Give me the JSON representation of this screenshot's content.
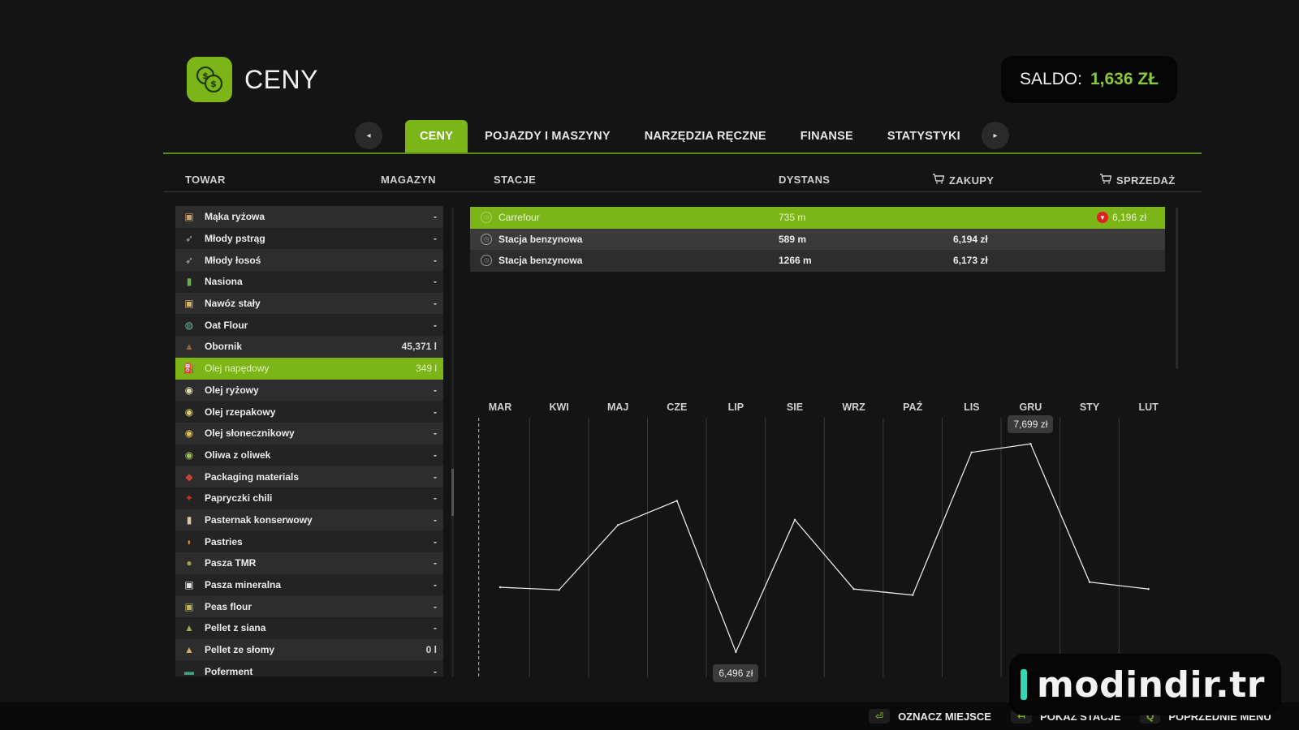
{
  "header": {
    "title": "CENY",
    "icon": "coins-icon"
  },
  "saldo": {
    "label": "SALDO:",
    "value": "1,636 ZŁ"
  },
  "tabs": {
    "prev_icon": "◂",
    "next_icon": "▸",
    "items": [
      {
        "label": "CENY",
        "active": true
      },
      {
        "label": "POJAZDY I MASZYNY",
        "active": false
      },
      {
        "label": "NARZĘDZIA RĘCZNE",
        "active": false
      },
      {
        "label": "FINANSE",
        "active": false
      },
      {
        "label": "STATYSTYKI",
        "active": false
      }
    ]
  },
  "columns": {
    "towar": "TOWAR",
    "magazyn": "MAGAZYN",
    "stacje": "STACJE",
    "dystans": "DYSTANS",
    "zakupy": "ZAKUPY",
    "sprzedaz": "SPRZEDAŻ"
  },
  "goods": [
    {
      "name": "Mąka ryżowa",
      "qty": "-",
      "icon": "▣",
      "color": "#c9a46a"
    },
    {
      "name": "Młody pstrąg",
      "qty": "-",
      "icon": "➶",
      "color": "#9fb0a0"
    },
    {
      "name": "Młody łosoś",
      "qty": "-",
      "icon": "➶",
      "color": "#b0b0b0"
    },
    {
      "name": "Nasiona",
      "qty": "-",
      "icon": "▮",
      "color": "#6ab04c"
    },
    {
      "name": "Nawóz stały",
      "qty": "-",
      "icon": "▣",
      "color": "#d9b36a"
    },
    {
      "name": "Oat Flour",
      "qty": "-",
      "icon": "◍",
      "color": "#6fb0a0"
    },
    {
      "name": "Obornik",
      "qty": "45,371 l",
      "icon": "▲",
      "color": "#8a6a3a"
    },
    {
      "name": "Olej napędowy",
      "qty": "349 l",
      "icon": "⛽",
      "color": "#d0d0d0",
      "selected": true
    },
    {
      "name": "Olej ryżowy",
      "qty": "-",
      "icon": "◉",
      "color": "#e0e0b0"
    },
    {
      "name": "Olej rzepakowy",
      "qty": "-",
      "icon": "◉",
      "color": "#e0d070"
    },
    {
      "name": "Olej słonecznikowy",
      "qty": "-",
      "icon": "◉",
      "color": "#e0c050"
    },
    {
      "name": "Oliwa z oliwek",
      "qty": "-",
      "icon": "◉",
      "color": "#a0c060"
    },
    {
      "name": "Packaging materials",
      "qty": "-",
      "icon": "◆",
      "color": "#d04030"
    },
    {
      "name": "Papryczki chili",
      "qty": "-",
      "icon": "✦",
      "color": "#d03020"
    },
    {
      "name": "Pasternak konserwowy",
      "qty": "-",
      "icon": "▮",
      "color": "#d8c8a8"
    },
    {
      "name": "Pastries",
      "qty": "-",
      "icon": "◗",
      "color": "#d89030"
    },
    {
      "name": "Pasza TMR",
      "qty": "-",
      "icon": "●",
      "color": "#a0a050"
    },
    {
      "name": "Pasza mineralna",
      "qty": "-",
      "icon": "▣",
      "color": "#e0e0e0"
    },
    {
      "name": "Peas flour",
      "qty": "-",
      "icon": "▣",
      "color": "#c0b060"
    },
    {
      "name": "Pellet z siana",
      "qty": "-",
      "icon": "▲",
      "color": "#90b050"
    },
    {
      "name": "Pellet ze słomy",
      "qty": "0 l",
      "icon": "▲",
      "color": "#d0b060"
    },
    {
      "name": "Poferment",
      "qty": "-",
      "icon": "▬",
      "color": "#40a080"
    }
  ],
  "stations": [
    {
      "name": "Carrefour",
      "distance": "735 m",
      "buy": "",
      "sell": "6,196 zł",
      "selected": true,
      "trend": "down"
    },
    {
      "name": "Stacja benzynowa",
      "distance": "589 m",
      "buy": "6,194 zł",
      "sell": ""
    },
    {
      "name": "Stacja benzynowa",
      "distance": "1266 m",
      "buy": "6,173 zł",
      "sell": ""
    }
  ],
  "chart_data": {
    "type": "line",
    "categories": [
      "MAR",
      "KWI",
      "MAJ",
      "CZE",
      "LIP",
      "SIE",
      "WRZ",
      "PAŹ",
      "LIS",
      "GRU",
      "STY",
      "LUT"
    ],
    "series": [
      {
        "values": [
          6870,
          6855,
          7230,
          7370,
          6496,
          7260,
          6860,
          6825,
          7650,
          7699,
          6900,
          6860
        ]
      }
    ],
    "annotations": [
      {
        "month": "LIP",
        "label": "6,496 zł"
      },
      {
        "month": "GRU",
        "label": "7,699 zł"
      }
    ],
    "ylim": [
      6350,
      7850
    ],
    "grid": "vertical"
  },
  "footer": {
    "hints": [
      {
        "key": "⏎",
        "label": "OZNACZ MIEJSCE"
      },
      {
        "key": "↤",
        "label": "POKAŻ STACJE"
      },
      {
        "key": "Q",
        "label": "POPRZEDNIE MENU"
      }
    ]
  },
  "watermark": {
    "text": "modindir.tr"
  },
  "colors": {
    "accent": "#7cb518",
    "saldo": "#8cc63f",
    "down": "#e02020"
  }
}
